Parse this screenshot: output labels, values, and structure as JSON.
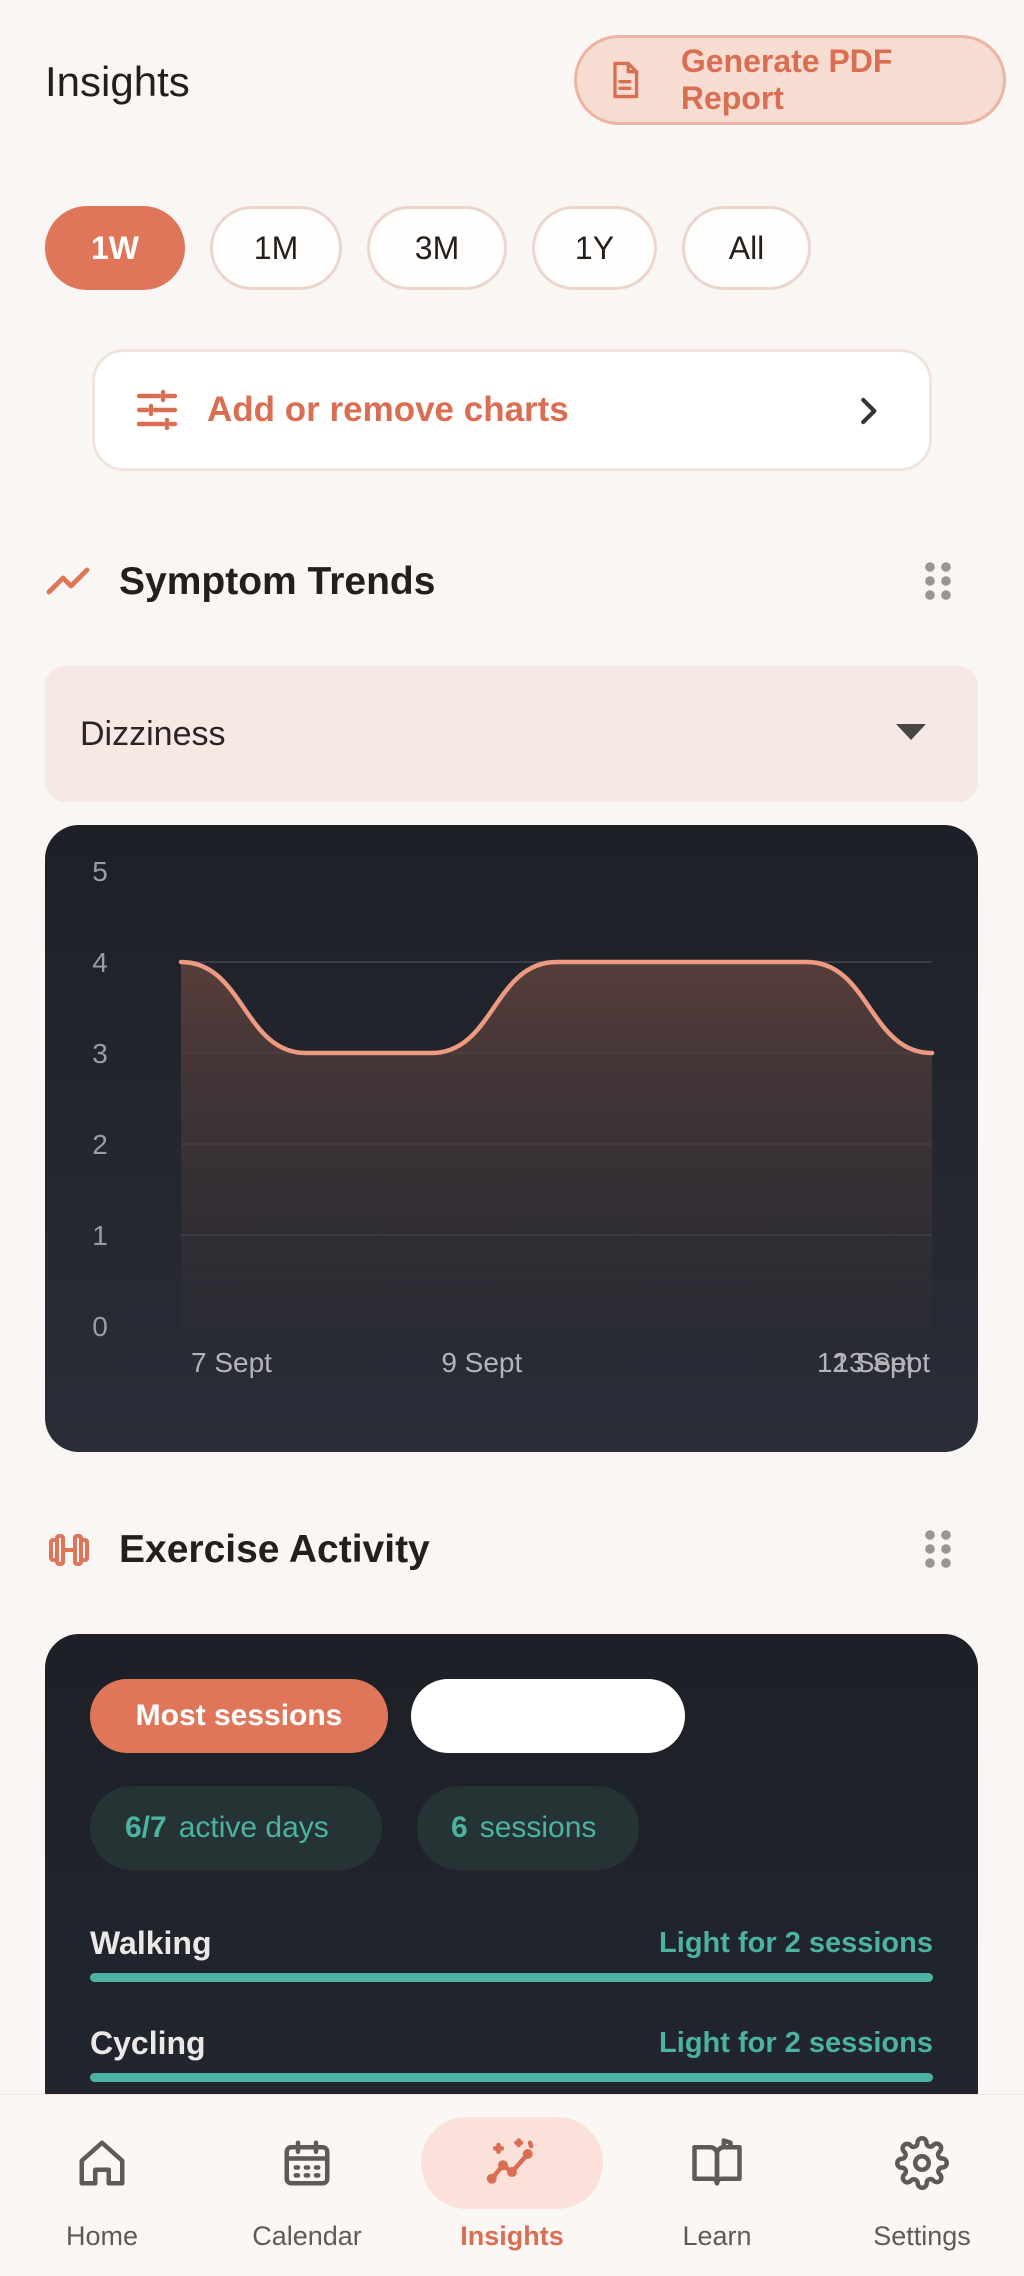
{
  "header": {
    "title": "Insights",
    "pdf_button": "Generate PDF Report"
  },
  "ranges": {
    "options": [
      "1W",
      "1M",
      "3M",
      "1Y",
      "All"
    ],
    "selected": "1W"
  },
  "add_charts": {
    "label": "Add or remove charts"
  },
  "symptom_section": {
    "title": "Symptom Trends",
    "selected_symptom": "Dizziness"
  },
  "chart_data": {
    "type": "area",
    "x": [
      "7 Sept",
      "8 Sept",
      "9 Sept",
      "10 Sept",
      "11 Sept",
      "12 Sept",
      "13 Sept"
    ],
    "x_tick_labels": [
      "7 Sept",
      "9 Sept",
      "12 Sept",
      "13 Sept"
    ],
    "series": [
      {
        "values": [
          4,
          3,
          3,
          4,
          4,
          4,
          3
        ]
      }
    ],
    "ylim": [
      0,
      5
    ],
    "y_ticks": [
      "5",
      "4",
      "3",
      "2",
      "1",
      "0"
    ],
    "grid": true,
    "colors": {
      "line": "#ee9a80",
      "fill": "#5a3f3c"
    }
  },
  "exercise_section": {
    "title": "Exercise Activity",
    "tabs": [
      "Most sessions",
      ""
    ],
    "stats": [
      {
        "value": "6/7",
        "label": "active days"
      },
      {
        "value": "6",
        "label": "sessions"
      }
    ],
    "activities": [
      {
        "name": "Walking",
        "detail": "Light for 2 sessions",
        "fill": 1.0
      },
      {
        "name": "Cycling",
        "detail": "Light for 2 sessions",
        "fill": 1.0
      }
    ]
  },
  "bottom_nav": {
    "items": [
      {
        "label": "Home",
        "icon": "home-icon"
      },
      {
        "label": "Calendar",
        "icon": "calendar-icon"
      },
      {
        "label": "Insights",
        "icon": "insights-icon"
      },
      {
        "label": "Learn",
        "icon": "book-icon"
      },
      {
        "label": "Settings",
        "icon": "gear-icon"
      }
    ],
    "active": "Insights"
  },
  "colors": {
    "accent": "#df765a",
    "teal": "#4bb3a1",
    "background": "#faf6f3",
    "card_dark": "#1d2027"
  }
}
